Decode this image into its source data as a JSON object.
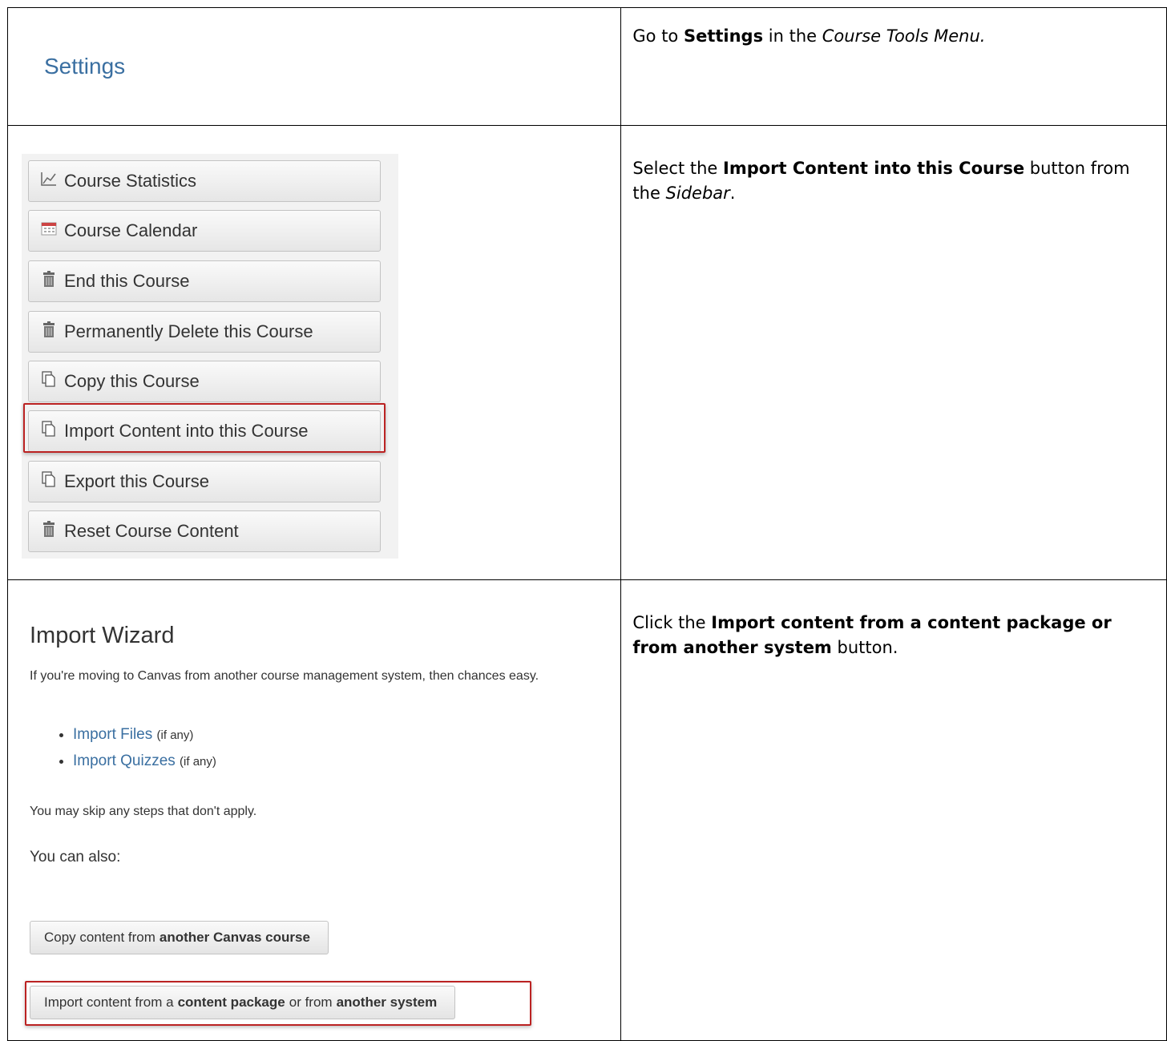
{
  "rows": [
    {
      "left": {
        "settings_label": "Settings"
      },
      "right": {
        "prefix": "Go to ",
        "bold1": "Settings",
        "mid": " in the ",
        "italic1": "Course Tools Menu."
      }
    },
    {
      "left": {
        "buttons": [
          {
            "label": "Course Statistics",
            "icon": "chart-icon"
          },
          {
            "label": "Course Calendar",
            "icon": "calendar-icon"
          },
          {
            "label": "End this Course",
            "icon": "trash-icon"
          },
          {
            "label": "Permanently Delete this Course",
            "icon": "trash-icon"
          },
          {
            "label": "Copy this Course",
            "icon": "copy-icon"
          },
          {
            "label": "Import Content into this Course",
            "icon": "copy-icon"
          },
          {
            "label": "Export this Course",
            "icon": "copy-icon"
          },
          {
            "label": "Reset Course Content",
            "icon": "trash-icon"
          }
        ]
      },
      "right": {
        "prefix": "Select the ",
        "bold1": "Import Content into this Course",
        "mid": " button from the ",
        "italic1": "Sidebar",
        "suffix": "."
      }
    },
    {
      "left": {
        "title": "Import Wizard",
        "intro": "If you're moving to Canvas from another course management system, then chances easy.",
        "list": [
          {
            "link": "Import Files",
            "note": "(if any)"
          },
          {
            "link": "Import Quizzes",
            "note": "(if any)"
          }
        ],
        "skip": "You may skip any steps that don't apply.",
        "also": "You can also:",
        "copy_btn": {
          "t1": "Copy content from",
          "b1": "another Canvas course"
        },
        "import_btn": {
          "t1": "Import content from a",
          "b1": "content package",
          "t2": "or from",
          "b2": "another system"
        }
      },
      "right": {
        "prefix": "Click the ",
        "bold1": "Import content from a content package or from another system",
        "suffix": " button."
      }
    }
  ],
  "colors": {
    "link": "#3a6fa1",
    "highlight": "#bb2222"
  }
}
